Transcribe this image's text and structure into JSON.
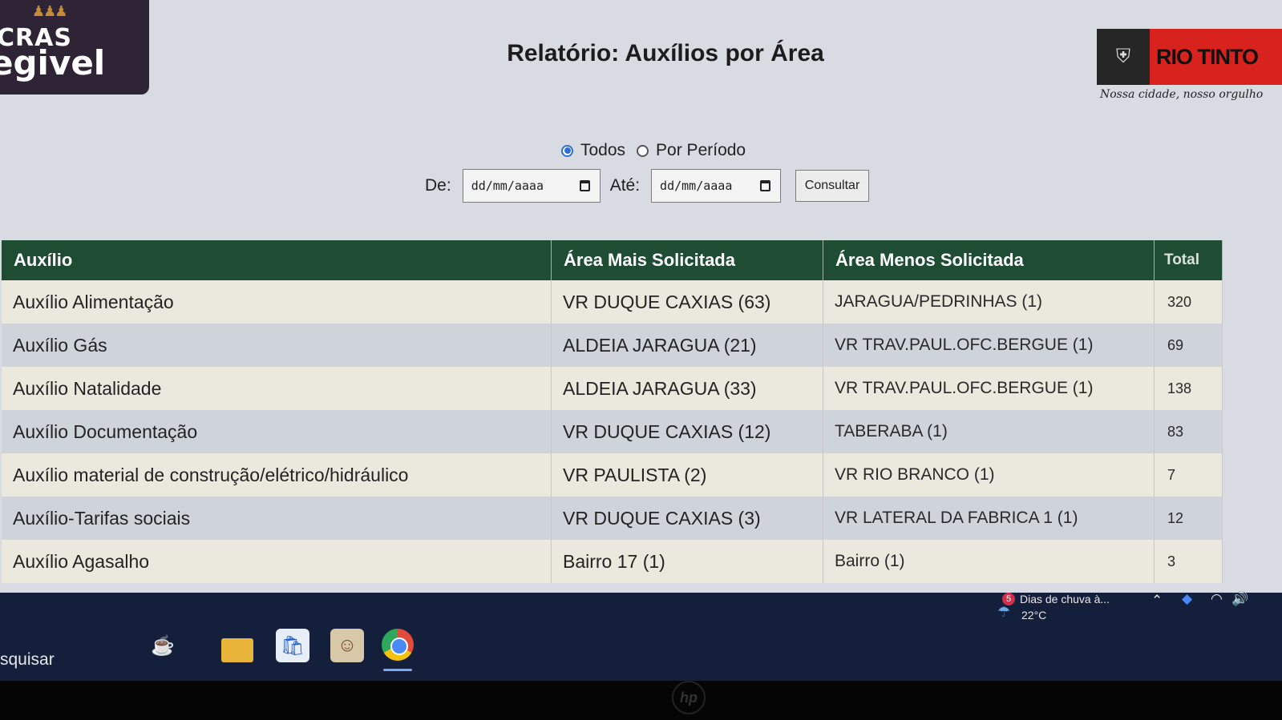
{
  "header": {
    "logo_left_line1": "CRAS",
    "logo_left_line2": "egivel",
    "title": "Relatório: Auxílios por Área",
    "logo_right_name": "RIO TINTO",
    "logo_right_slogan": "Nossa cidade, nosso orgulho"
  },
  "filters": {
    "mode_options": [
      {
        "label": "Todos",
        "selected": true
      },
      {
        "label": "Por Período",
        "selected": false
      }
    ],
    "from_label": "De:",
    "from_placeholder": "dd/mm/aaaa",
    "to_label": "Até:",
    "to_placeholder": "dd/mm/aaaa",
    "submit_label": "Consultar"
  },
  "table": {
    "columns": [
      "Auxílio",
      "Área Mais Solicitada",
      "Área Menos Solicitada",
      "Total"
    ],
    "rows": [
      {
        "auxilio": "Auxílio Alimentação",
        "mais": "VR DUQUE CAXIAS (63)",
        "menos": "JARAGUA/PEDRINHAS (1)",
        "total": "320"
      },
      {
        "auxilio": "Auxílio Gás",
        "mais": "ALDEIA JARAGUA (21)",
        "menos": "VR TRAV.PAUL.OFC.BERGUE (1)",
        "total": "69"
      },
      {
        "auxilio": "Auxílio Natalidade",
        "mais": "ALDEIA JARAGUA (33)",
        "menos": "VR TRAV.PAUL.OFC.BERGUE (1)",
        "total": "138"
      },
      {
        "auxilio": "Auxílio Documentação",
        "mais": "VR DUQUE CAXIAS (12)",
        "menos": "TABERABA (1)",
        "total": "83"
      },
      {
        "auxilio": "Auxílio material de construção/elétrico/hidráulico",
        "mais": "VR PAULISTA (2)",
        "menos": "VR RIO BRANCO (1)",
        "total": "7"
      },
      {
        "auxilio": "Auxílio-Tarifas sociais",
        "mais": "VR DUQUE CAXIAS (3)",
        "menos": "VR LATERAL DA FABRICA 1 (1)",
        "total": "12"
      },
      {
        "auxilio": "Auxílio Agasalho",
        "mais": "Bairro 17 (1)",
        "menos": "Bairro (1)",
        "total": "3"
      }
    ]
  },
  "taskbar": {
    "search_text": "squisar",
    "weather_badge": "5",
    "weather_text": "Dias de chuva à...",
    "weather_temp": "22°C",
    "icons": [
      "widgets-icon",
      "file-explorer-icon",
      "store-icon",
      "game-icon",
      "chrome-icon"
    ]
  },
  "colors": {
    "table_header": "#1f4d34",
    "row_odd": "#ebe8de",
    "row_even": "#cfd3da",
    "taskbar": "#14203b",
    "radio_accent": "#2f6fd1",
    "logo_red": "#d7221e"
  }
}
